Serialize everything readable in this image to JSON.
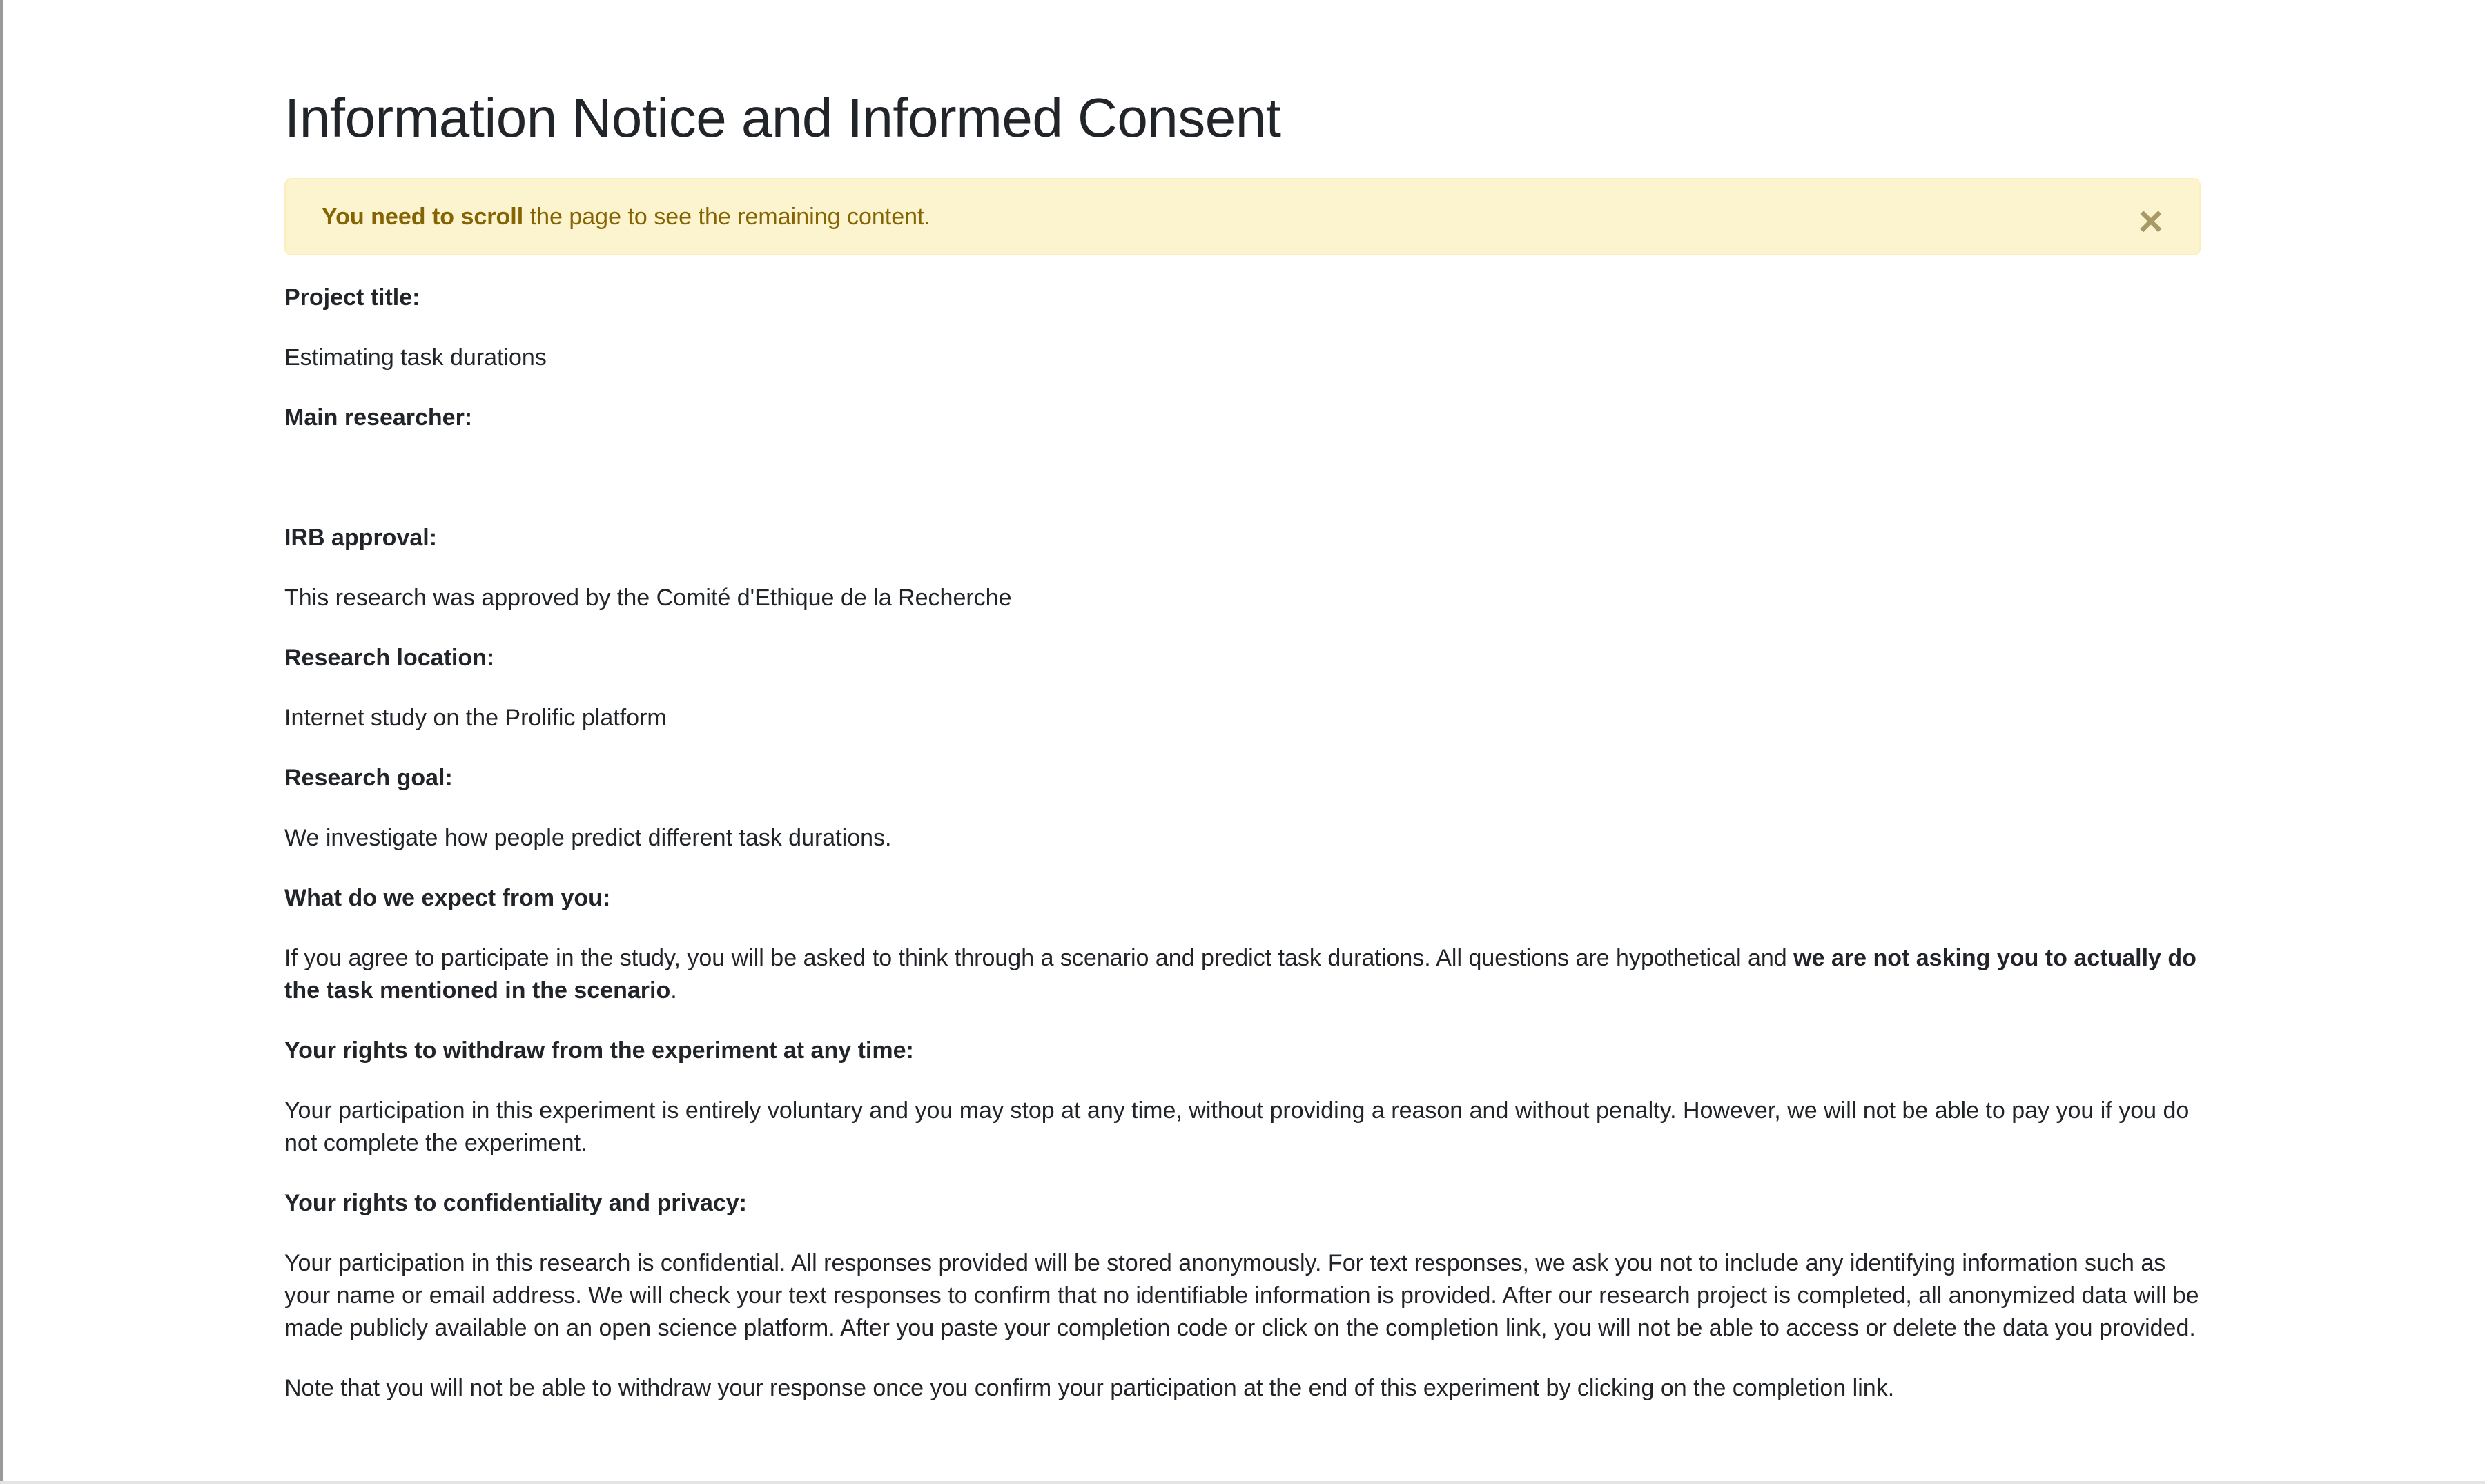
{
  "page": {
    "title": "Information Notice and Informed Consent"
  },
  "alert": {
    "bold_text": "You need to scroll",
    "text": " the page to see the remaining content.",
    "close_symbol": "×"
  },
  "sections": {
    "project_title": {
      "label": "Project title:",
      "value": "Estimating task durations"
    },
    "main_researcher": {
      "label": "Main researcher:",
      "value": ""
    },
    "irb_approval": {
      "label": "IRB approval:",
      "value": "This research was approved by the Comité d'Ethique de la Recherche"
    },
    "research_location": {
      "label": "Research location:",
      "value": "Internet study on the Prolific platform"
    },
    "research_goal": {
      "label": "Research goal:",
      "value": "We investigate how people predict different task durations."
    },
    "expectations": {
      "label": "What do we expect from you:",
      "value_start": "If you agree to participate in the study, you will be asked to think through a scenario and predict task durations. All questions are hypothetical and ",
      "value_bold": "we are not asking you to actually do the task mentioned in the scenario",
      "value_end": "."
    },
    "withdraw": {
      "label": "Your rights to withdraw from the experiment at any time:",
      "value": "Your participation in this experiment is entirely voluntary and you may stop at any time, without providing a reason and without penalty. However, we will not be able to pay you if you do not complete the experiment."
    },
    "confidentiality": {
      "label": "Your rights to confidentiality and privacy:",
      "value": "Your participation in this research is confidential. All responses provided will be stored anonymously. For text responses, we ask you not to include any identifying information such as your name or email address. We will check your text responses to confirm that no identifiable information is provided. After our research project is completed, all anonymized data will be made publicly available on an open science platform. After you paste your completion code or click on the completion link, you will not be able to access or delete the data you provided."
    },
    "note": {
      "value": "Note that you will not be able to withdraw your response once you confirm your participation at the end of this experiment by clicking on the completion link."
    }
  },
  "colors": {
    "alert_background": "#fcf3cf",
    "alert_text": "#856404",
    "body_text": "#212529"
  }
}
